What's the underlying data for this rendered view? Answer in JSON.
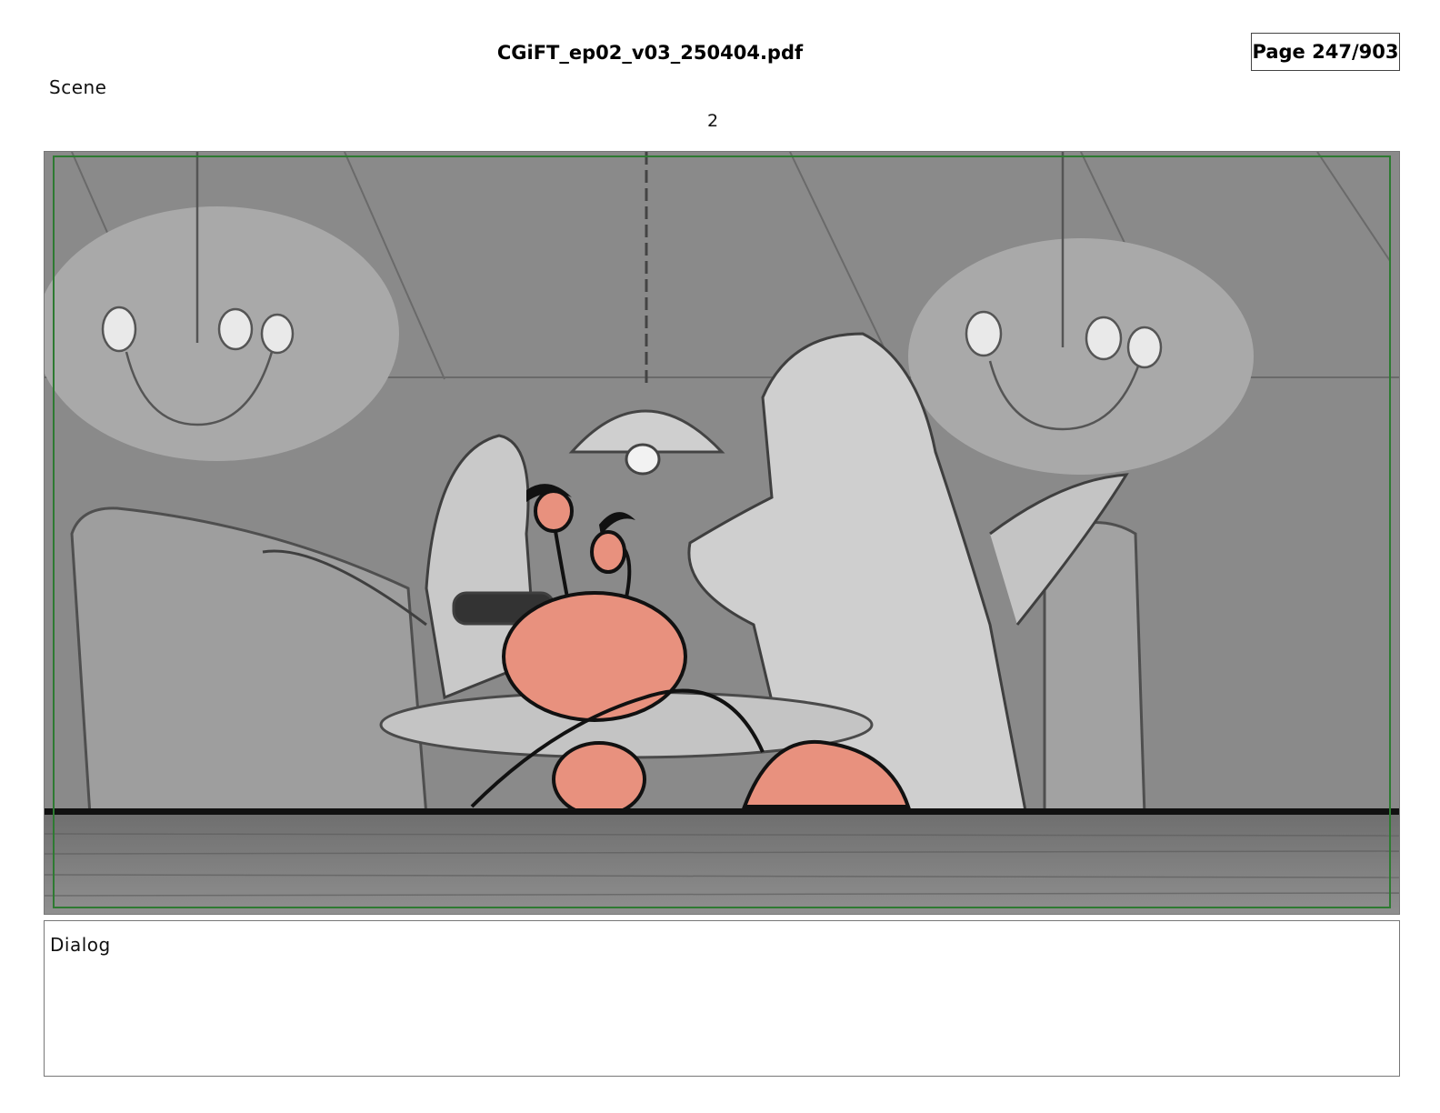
{
  "header": {
    "file_name": "CGiFT_ep02_v03_250404.pdf",
    "page_indicator": "Page 247/903"
  },
  "scene": {
    "label": "Scene",
    "number": "2"
  },
  "panel": {
    "colors": {
      "background_gray": "#8a8a8a",
      "character_gray": "#c9c9c9",
      "crab_salmon": "#e8917e",
      "ink": "#111111",
      "safe_frame_green": "#2e7a32",
      "table_wood": "#7a7a7a"
    }
  },
  "dialog": {
    "label": "Dialog",
    "text": ""
  }
}
